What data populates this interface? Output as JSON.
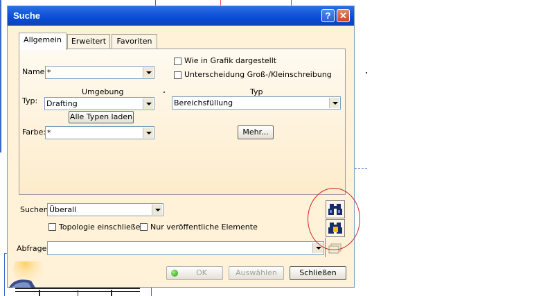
{
  "dialog": {
    "title": "Suche",
    "help_glyph": "?",
    "close_glyph": "✕"
  },
  "tabs": [
    {
      "label": "Allgemein",
      "active": true
    },
    {
      "label": "Erweitert",
      "active": false
    },
    {
      "label": "Favoriten",
      "active": false
    }
  ],
  "general": {
    "name_label": "Name:",
    "name_value": "*",
    "umgebung_header": "Umgebung",
    "typ_label": "Typ:",
    "typ_value": "Drafting",
    "load_all_types_button": "Alle Typen laden",
    "farbe_label": "Farbe:",
    "farbe_value": "*",
    "graphic_checkbox_label": "Wie in Grafik dargestellt",
    "graphic_checked": false,
    "case_checkbox_label": "Unterscheidung Groß-/Kleinschreibung",
    "case_checked": false,
    "typ_header": "Typ",
    "typ2_value": "Bereichsfüllung",
    "more_button": "Mehr..."
  },
  "search": {
    "suchen_label": "Suchen:",
    "suchen_value": "Überall",
    "topology_label": "Topologie einschließen",
    "topology_checked": false,
    "published_label": "Nur veröffentliche Elemente",
    "published_checked": false,
    "query_label": "Abfrage:",
    "query_value": ""
  },
  "side_buttons": [
    {
      "icon": "binoculars-icon"
    },
    {
      "icon": "binoculars-append-icon"
    },
    {
      "icon": "favorites-icon"
    }
  ],
  "footer": {
    "ok_button": "OK",
    "select_button": "Auswählen",
    "close_button": "Schließen"
  },
  "colors": {
    "title_bar": "#0a4bd6",
    "dialog_bg": "#fff2d8",
    "annotation_circle": "#cc2222"
  }
}
